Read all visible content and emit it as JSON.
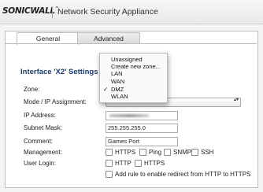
{
  "header": {
    "logo_text": "SONICWALL",
    "logo_tm": "™",
    "title": "Network Security Appliance"
  },
  "tabs": [
    {
      "label": "General",
      "active": true
    },
    {
      "label": "Advanced",
      "active": false
    }
  ],
  "section_title": "Interface 'X2' Settings",
  "labels": {
    "zone": "Zone:",
    "mode": "Mode / IP Assignment:",
    "ip": "IP Address:",
    "subnet": "Subnet Mask:",
    "comment": "Comment:",
    "management": "Management:",
    "user_login": "User Login:"
  },
  "fields": {
    "subnet_mask": "255.255.255.0",
    "comment": "Games Port"
  },
  "management_options": [
    "HTTPS",
    "Ping",
    "SNMP",
    "SSH"
  ],
  "user_login_options": [
    "HTTP",
    "HTTPS"
  ],
  "redirect_option": "Add rule to enable redirect from HTTP to HTTPS",
  "zone_dropdown": {
    "options": [
      "Unassigned",
      "Create new zone...",
      "LAN",
      "WAN",
      "DMZ",
      "WLAN"
    ],
    "selected": "DMZ",
    "check_mark": "✓"
  },
  "select_arrows": "▴▾"
}
